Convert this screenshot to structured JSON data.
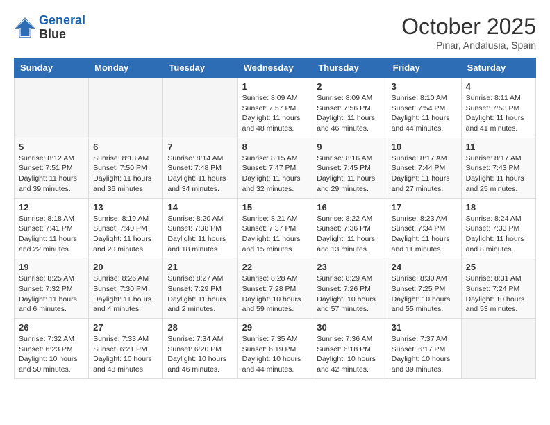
{
  "header": {
    "logo_line1": "General",
    "logo_line2": "Blue",
    "month": "October 2025",
    "location": "Pinar, Andalusia, Spain"
  },
  "weekdays": [
    "Sunday",
    "Monday",
    "Tuesday",
    "Wednesday",
    "Thursday",
    "Friday",
    "Saturday"
  ],
  "weeks": [
    [
      {
        "day": "",
        "info": ""
      },
      {
        "day": "",
        "info": ""
      },
      {
        "day": "",
        "info": ""
      },
      {
        "day": "1",
        "info": "Sunrise: 8:09 AM\nSunset: 7:57 PM\nDaylight: 11 hours\nand 48 minutes."
      },
      {
        "day": "2",
        "info": "Sunrise: 8:09 AM\nSunset: 7:56 PM\nDaylight: 11 hours\nand 46 minutes."
      },
      {
        "day": "3",
        "info": "Sunrise: 8:10 AM\nSunset: 7:54 PM\nDaylight: 11 hours\nand 44 minutes."
      },
      {
        "day": "4",
        "info": "Sunrise: 8:11 AM\nSunset: 7:53 PM\nDaylight: 11 hours\nand 41 minutes."
      }
    ],
    [
      {
        "day": "5",
        "info": "Sunrise: 8:12 AM\nSunset: 7:51 PM\nDaylight: 11 hours\nand 39 minutes."
      },
      {
        "day": "6",
        "info": "Sunrise: 8:13 AM\nSunset: 7:50 PM\nDaylight: 11 hours\nand 36 minutes."
      },
      {
        "day": "7",
        "info": "Sunrise: 8:14 AM\nSunset: 7:48 PM\nDaylight: 11 hours\nand 34 minutes."
      },
      {
        "day": "8",
        "info": "Sunrise: 8:15 AM\nSunset: 7:47 PM\nDaylight: 11 hours\nand 32 minutes."
      },
      {
        "day": "9",
        "info": "Sunrise: 8:16 AM\nSunset: 7:45 PM\nDaylight: 11 hours\nand 29 minutes."
      },
      {
        "day": "10",
        "info": "Sunrise: 8:17 AM\nSunset: 7:44 PM\nDaylight: 11 hours\nand 27 minutes."
      },
      {
        "day": "11",
        "info": "Sunrise: 8:17 AM\nSunset: 7:43 PM\nDaylight: 11 hours\nand 25 minutes."
      }
    ],
    [
      {
        "day": "12",
        "info": "Sunrise: 8:18 AM\nSunset: 7:41 PM\nDaylight: 11 hours\nand 22 minutes."
      },
      {
        "day": "13",
        "info": "Sunrise: 8:19 AM\nSunset: 7:40 PM\nDaylight: 11 hours\nand 20 minutes."
      },
      {
        "day": "14",
        "info": "Sunrise: 8:20 AM\nSunset: 7:38 PM\nDaylight: 11 hours\nand 18 minutes."
      },
      {
        "day": "15",
        "info": "Sunrise: 8:21 AM\nSunset: 7:37 PM\nDaylight: 11 hours\nand 15 minutes."
      },
      {
        "day": "16",
        "info": "Sunrise: 8:22 AM\nSunset: 7:36 PM\nDaylight: 11 hours\nand 13 minutes."
      },
      {
        "day": "17",
        "info": "Sunrise: 8:23 AM\nSunset: 7:34 PM\nDaylight: 11 hours\nand 11 minutes."
      },
      {
        "day": "18",
        "info": "Sunrise: 8:24 AM\nSunset: 7:33 PM\nDaylight: 11 hours\nand 8 minutes."
      }
    ],
    [
      {
        "day": "19",
        "info": "Sunrise: 8:25 AM\nSunset: 7:32 PM\nDaylight: 11 hours\nand 6 minutes."
      },
      {
        "day": "20",
        "info": "Sunrise: 8:26 AM\nSunset: 7:30 PM\nDaylight: 11 hours\nand 4 minutes."
      },
      {
        "day": "21",
        "info": "Sunrise: 8:27 AM\nSunset: 7:29 PM\nDaylight: 11 hours\nand 2 minutes."
      },
      {
        "day": "22",
        "info": "Sunrise: 8:28 AM\nSunset: 7:28 PM\nDaylight: 10 hours\nand 59 minutes."
      },
      {
        "day": "23",
        "info": "Sunrise: 8:29 AM\nSunset: 7:26 PM\nDaylight: 10 hours\nand 57 minutes."
      },
      {
        "day": "24",
        "info": "Sunrise: 8:30 AM\nSunset: 7:25 PM\nDaylight: 10 hours\nand 55 minutes."
      },
      {
        "day": "25",
        "info": "Sunrise: 8:31 AM\nSunset: 7:24 PM\nDaylight: 10 hours\nand 53 minutes."
      }
    ],
    [
      {
        "day": "26",
        "info": "Sunrise: 7:32 AM\nSunset: 6:23 PM\nDaylight: 10 hours\nand 50 minutes."
      },
      {
        "day": "27",
        "info": "Sunrise: 7:33 AM\nSunset: 6:21 PM\nDaylight: 10 hours\nand 48 minutes."
      },
      {
        "day": "28",
        "info": "Sunrise: 7:34 AM\nSunset: 6:20 PM\nDaylight: 10 hours\nand 46 minutes."
      },
      {
        "day": "29",
        "info": "Sunrise: 7:35 AM\nSunset: 6:19 PM\nDaylight: 10 hours\nand 44 minutes."
      },
      {
        "day": "30",
        "info": "Sunrise: 7:36 AM\nSunset: 6:18 PM\nDaylight: 10 hours\nand 42 minutes."
      },
      {
        "day": "31",
        "info": "Sunrise: 7:37 AM\nSunset: 6:17 PM\nDaylight: 10 hours\nand 39 minutes."
      },
      {
        "day": "",
        "info": ""
      }
    ]
  ]
}
